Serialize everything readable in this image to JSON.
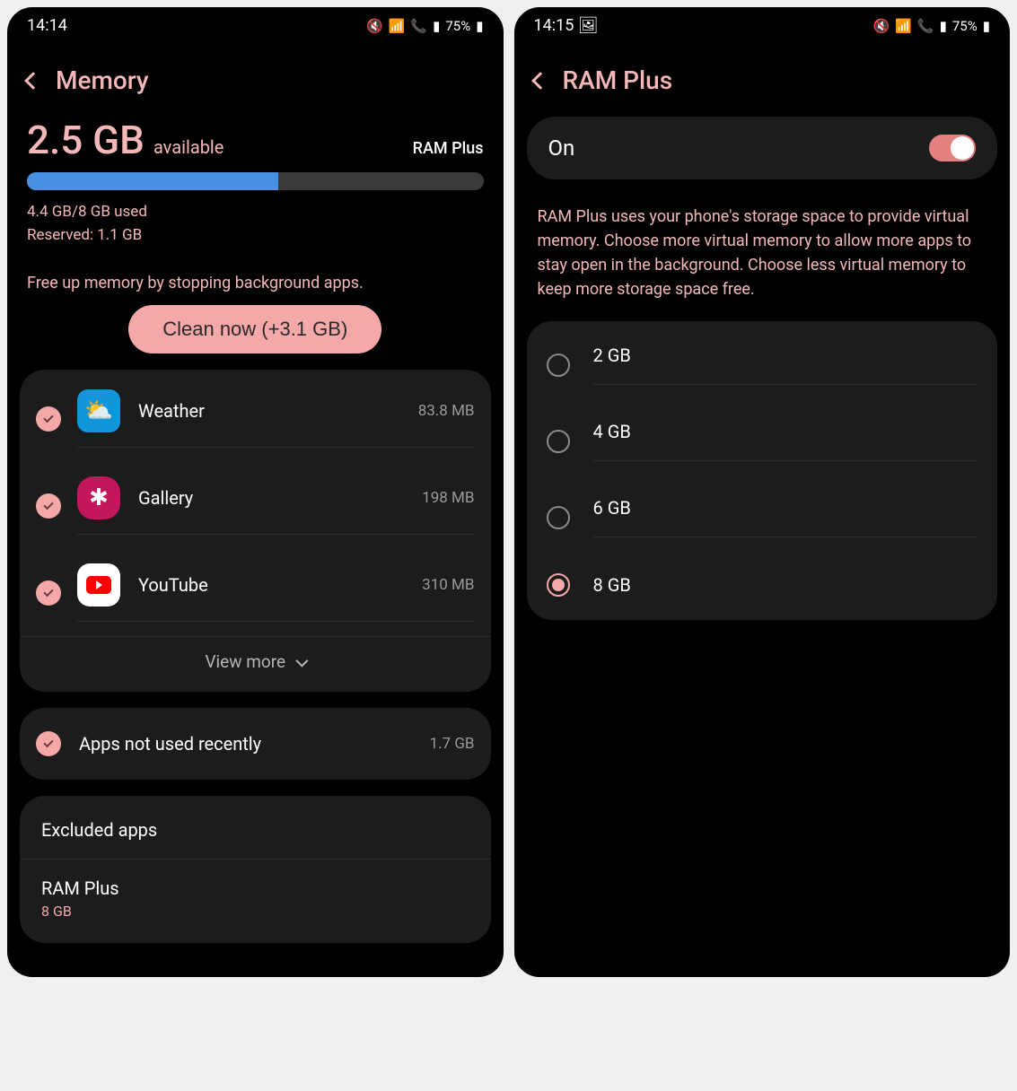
{
  "left": {
    "status": {
      "time": "14:14",
      "battery": "75%"
    },
    "header": {
      "title": "Memory"
    },
    "summary": {
      "amount": "2.5 GB",
      "word": "available",
      "ram_plus_link": "RAM Plus",
      "progress_percent": 55,
      "usage_line1": "4.4 GB/8 GB used",
      "usage_line2": "Reserved: 1.1 GB"
    },
    "free_up_text": "Free up memory by stopping background apps.",
    "clean_button": "Clean now (+3.1 GB)",
    "apps": [
      {
        "name": "Weather",
        "size": "83.8 MB",
        "icon": "weather"
      },
      {
        "name": "Gallery",
        "size": "198 MB",
        "icon": "gallery"
      },
      {
        "name": "YouTube",
        "size": "310 MB",
        "icon": "youtube"
      }
    ],
    "view_more": "View more",
    "not_used": {
      "title": "Apps not used recently",
      "size": "1.7 GB"
    },
    "settings": {
      "excluded": "Excluded apps",
      "ram_plus_title": "RAM Plus",
      "ram_plus_value": "8 GB"
    }
  },
  "right": {
    "status": {
      "time": "14:15",
      "battery": "75%"
    },
    "header": {
      "title": "RAM Plus"
    },
    "switch_label": "On",
    "description": "RAM Plus uses your phone's storage space to provide virtual memory. Choose more virtual memory to allow more apps to stay open in the background. Choose less virtual memory to keep more storage space free.",
    "options": [
      {
        "label": "2 GB",
        "selected": false
      },
      {
        "label": "4 GB",
        "selected": false
      },
      {
        "label": "6 GB",
        "selected": false
      },
      {
        "label": "8 GB",
        "selected": true
      }
    ]
  }
}
